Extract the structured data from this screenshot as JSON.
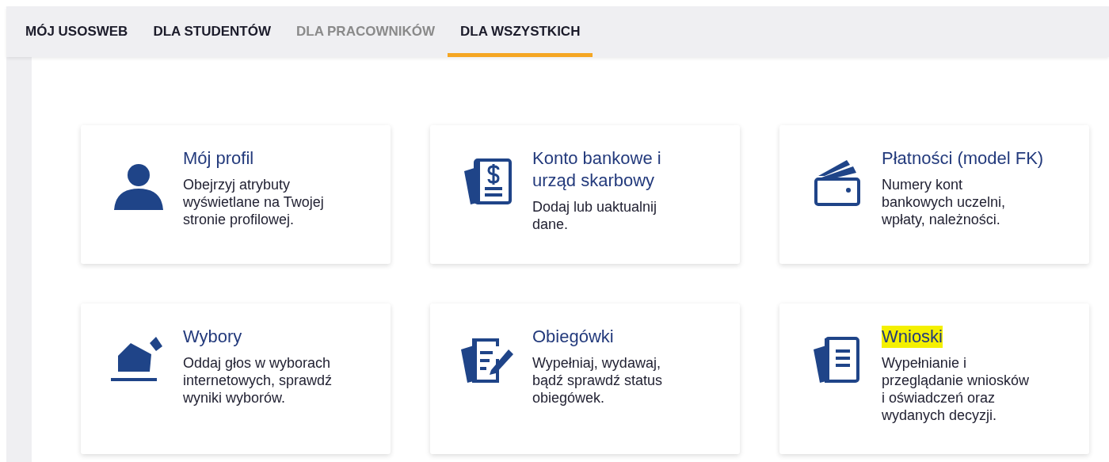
{
  "nav": {
    "tabs": [
      {
        "label": "MÓJ USOSWEB",
        "selected": false,
        "disabled": false
      },
      {
        "label": "DLA STUDENTÓW",
        "selected": false,
        "disabled": false
      },
      {
        "label": "DLA PRACOWNIKÓW",
        "selected": false,
        "disabled": true
      },
      {
        "label": "DLA WSZYSTKICH",
        "selected": true,
        "disabled": false
      }
    ]
  },
  "tiles": [
    {
      "kind": "person",
      "title_lines": [
        "Mój profil"
      ],
      "highlighted": false,
      "description_lines": [
        "Obejrzyj atrybuty",
        "wyświetlane na Twojej",
        "stronie profilowej."
      ]
    },
    {
      "kind": "bank",
      "title_lines": [
        "Konto bankowe i",
        "urząd skarbowy"
      ],
      "highlighted": false,
      "description_lines": [
        "Dodaj lub uaktualnij",
        "dane."
      ]
    },
    {
      "kind": "wallet",
      "title_lines": [
        "Płatności (model FK)"
      ],
      "highlighted": false,
      "description_lines": [
        "Numery kont",
        "bankowych uczelni,",
        "wpłaty, należności."
      ]
    },
    {
      "kind": "ballot",
      "title_lines": [
        "Wybory"
      ],
      "highlighted": false,
      "description_lines": [
        "Oddaj głos w wyborach",
        "internetowych, sprawdź",
        "wyniki wyborów."
      ]
    },
    {
      "kind": "form",
      "title_lines": [
        "Obiegówki"
      ],
      "highlighted": false,
      "description_lines": [
        "Wypełniaj, wydawaj,",
        "bądź sprawdź status",
        "obiegówek."
      ]
    },
    {
      "kind": "document",
      "title_lines": [
        "Wnioski"
      ],
      "highlighted": true,
      "description_lines": [
        "Wypełnianie i",
        "przeglądanie wniosków",
        "i oświadczeń oraz",
        "wydanych decyzji."
      ]
    }
  ]
}
